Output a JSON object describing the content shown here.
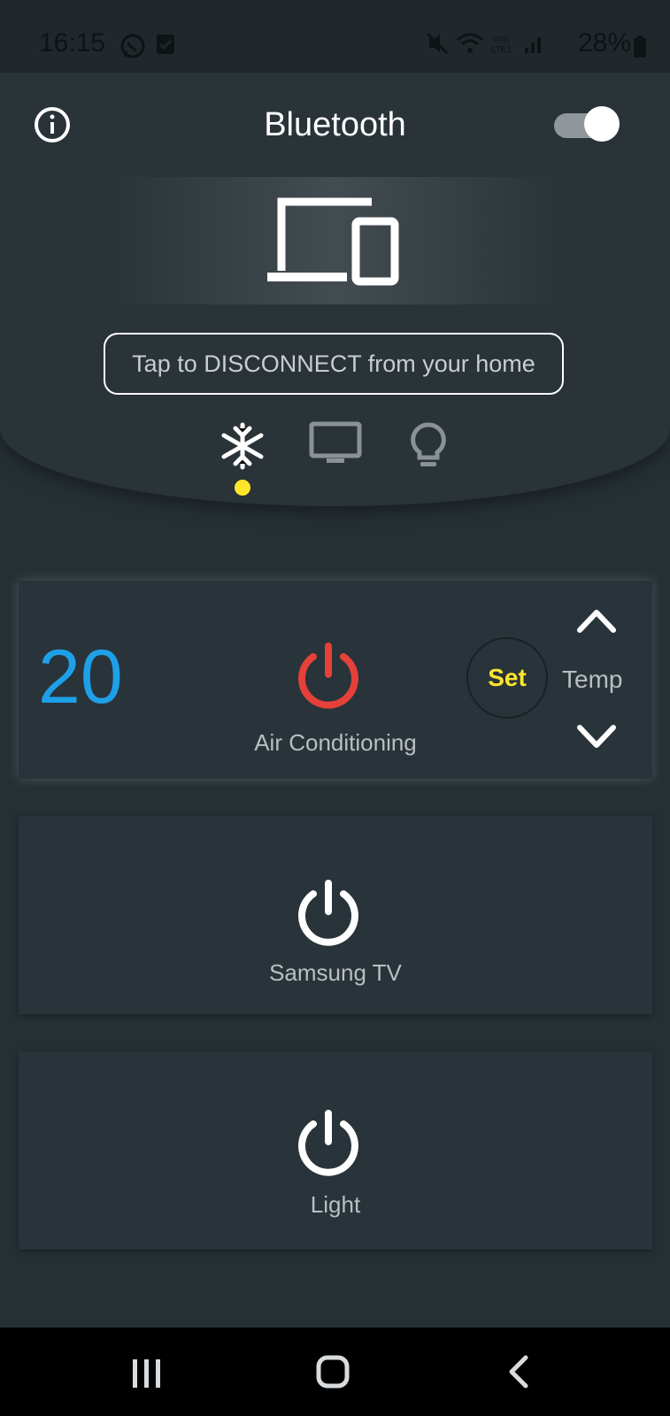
{
  "status_bar": {
    "time": "16:15",
    "battery": "28%",
    "icons": [
      "whatsapp-icon",
      "checkbox-icon",
      "mute-icon",
      "wifi-icon",
      "volte-icon",
      "signal-icon",
      "battery-icon"
    ]
  },
  "header": {
    "title": "Bluetooth",
    "toggle_on": true,
    "disconnect_label": "Tap to DISCONNECT from your home",
    "modes": [
      "snowflake-icon",
      "tv-icon",
      "lightbulb-icon"
    ],
    "active_mode": "snowflake-icon",
    "accent_color": "#ffe629"
  },
  "devices": {
    "ac": {
      "temperature": "20",
      "label": "Air Conditioning",
      "set_label": "Set",
      "temp_label": "Temp",
      "power_color": "#e5413a",
      "temp_color": "#1ea0e8"
    },
    "tv": {
      "label": "Samsung TV"
    },
    "light": {
      "label": "Light"
    }
  }
}
